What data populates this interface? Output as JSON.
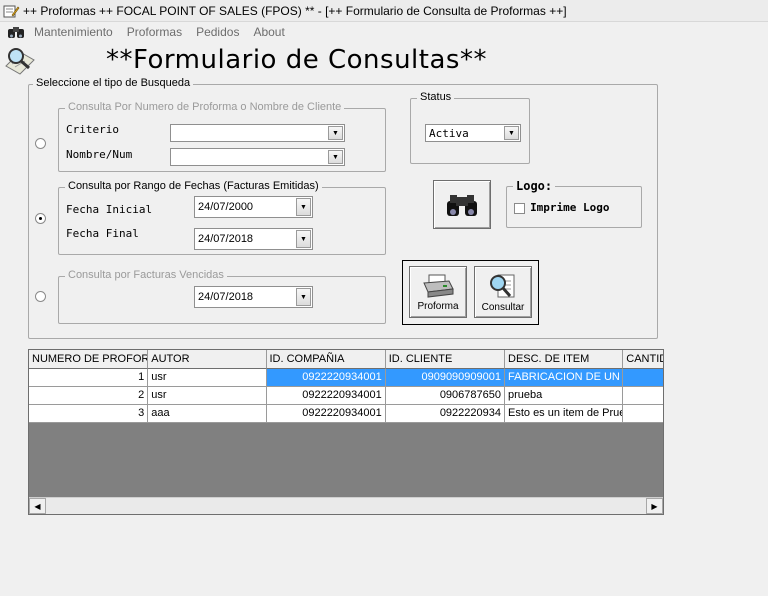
{
  "window": {
    "title": "++ Proformas ++ FOCAL POINT OF SALES (FPOS) ** - [++ Formulario de Consulta de Proformas ++]"
  },
  "menu": {
    "items": [
      "Mantenimiento",
      "Proformas",
      "Pedidos",
      "About"
    ]
  },
  "form": {
    "heading": "**Formulario de Consultas**",
    "search_type_group": "Seleccione el tipo de Busqueda",
    "by_number": {
      "legend": "Consulta Por Numero de Proforma o Nombre de Cliente",
      "criterio_label": "Criterio",
      "criterio_value": "",
      "nombre_label": "Nombre/Num",
      "nombre_value": ""
    },
    "by_date": {
      "legend": "Consulta por Rango de Fechas (Facturas Emitidas)",
      "fecha_inicial_label": "Fecha Inicial",
      "fecha_inicial_value": "24/07/2000",
      "fecha_final_label": "Fecha Final",
      "fecha_final_value": "24/07/2018"
    },
    "by_overdue": {
      "legend": "Consulta por Facturas Vencidas",
      "fecha_value": "24/07/2018"
    },
    "status": {
      "legend": "Status",
      "value": "Activa"
    },
    "logo": {
      "legend": "Logo:",
      "checkbox_label": "Imprime Logo",
      "checked": false
    },
    "buttons": {
      "proforma": "Proforma",
      "consultar": "Consultar"
    },
    "selected_search": "by_date"
  },
  "grid": {
    "columns": [
      "NUMERO DE PROFORMA",
      "AUTOR",
      "ID. COMPAÑIA",
      "ID. CLIENTE",
      "DESC. DE ITEM",
      "CANTIDAD"
    ],
    "rows": [
      [
        "1",
        "usr",
        "0922220934001",
        "0909090909001",
        "FABRICACION DE UN",
        ""
      ],
      [
        "2",
        "usr",
        "0922220934001",
        "0906787650",
        "prueba",
        ""
      ],
      [
        "3",
        "aaa",
        "0922220934001",
        "0922220934",
        "Esto es un item de Prueba",
        ""
      ]
    ],
    "selected_row": 0
  },
  "icons": {
    "app": "pencil-document-icon",
    "toolbar": "binoculars-icon",
    "form": "magnifier-document-icon"
  },
  "colors": {
    "selection": "#3399ff",
    "grid_empty": "#808080"
  }
}
